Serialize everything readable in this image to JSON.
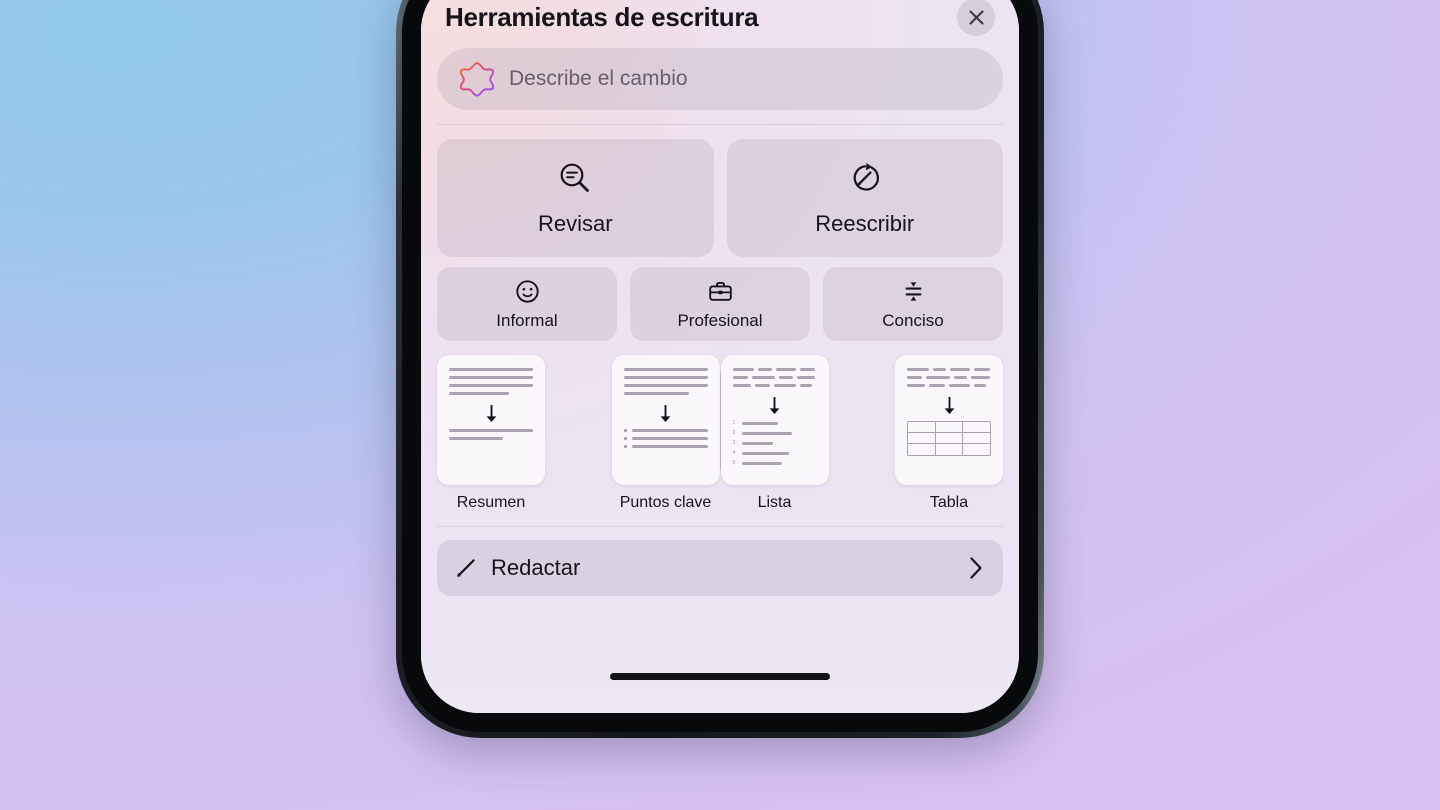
{
  "wallpaper": {
    "gradient_start": "#8ec9e9",
    "gradient_end": "#d6bff0"
  },
  "device": {
    "name": "iphone-frame",
    "frame_color": "#1b1f24",
    "home_indicator": true
  },
  "panel": {
    "title": "Herramientas de escritura",
    "close_label": "×",
    "grabber": true,
    "accent_colors": {
      "panel_bg_start": "#f7dedf",
      "panel_bg_end": "#ebe5f5",
      "text": "#16141a",
      "muted_text": "#645f6b"
    }
  },
  "prompt": {
    "placeholder": "Describe el cambio",
    "icon": "apple-intelligence-icon",
    "icon_gradient": [
      "#f0702a",
      "#e8456f",
      "#b44ad6",
      "#7a5cf0"
    ]
  },
  "primary_actions": [
    {
      "label": "Revisar",
      "icon": "proofread-magnifier-icon"
    },
    {
      "label": "Reescribir",
      "icon": "rewrite-circle-pencil-icon"
    }
  ],
  "tone_actions": [
    {
      "label": "Informal",
      "icon": "smiley-face-icon"
    },
    {
      "label": "Profesional",
      "icon": "briefcase-icon"
    },
    {
      "label": "Conciso",
      "icon": "compress-icon"
    }
  ],
  "transform_cards": [
    {
      "label": "Resumen",
      "icon": "summary-card-icon"
    },
    {
      "label": "Puntos clave",
      "icon": "key-points-card-icon"
    },
    {
      "label": "Lista",
      "icon": "list-card-icon"
    },
    {
      "label": "Tabla",
      "icon": "table-card-icon"
    }
  ],
  "compose": {
    "label": "Redactar",
    "leading_icon": "pencil-icon",
    "trailing_icon": "chevron-right-icon"
  }
}
